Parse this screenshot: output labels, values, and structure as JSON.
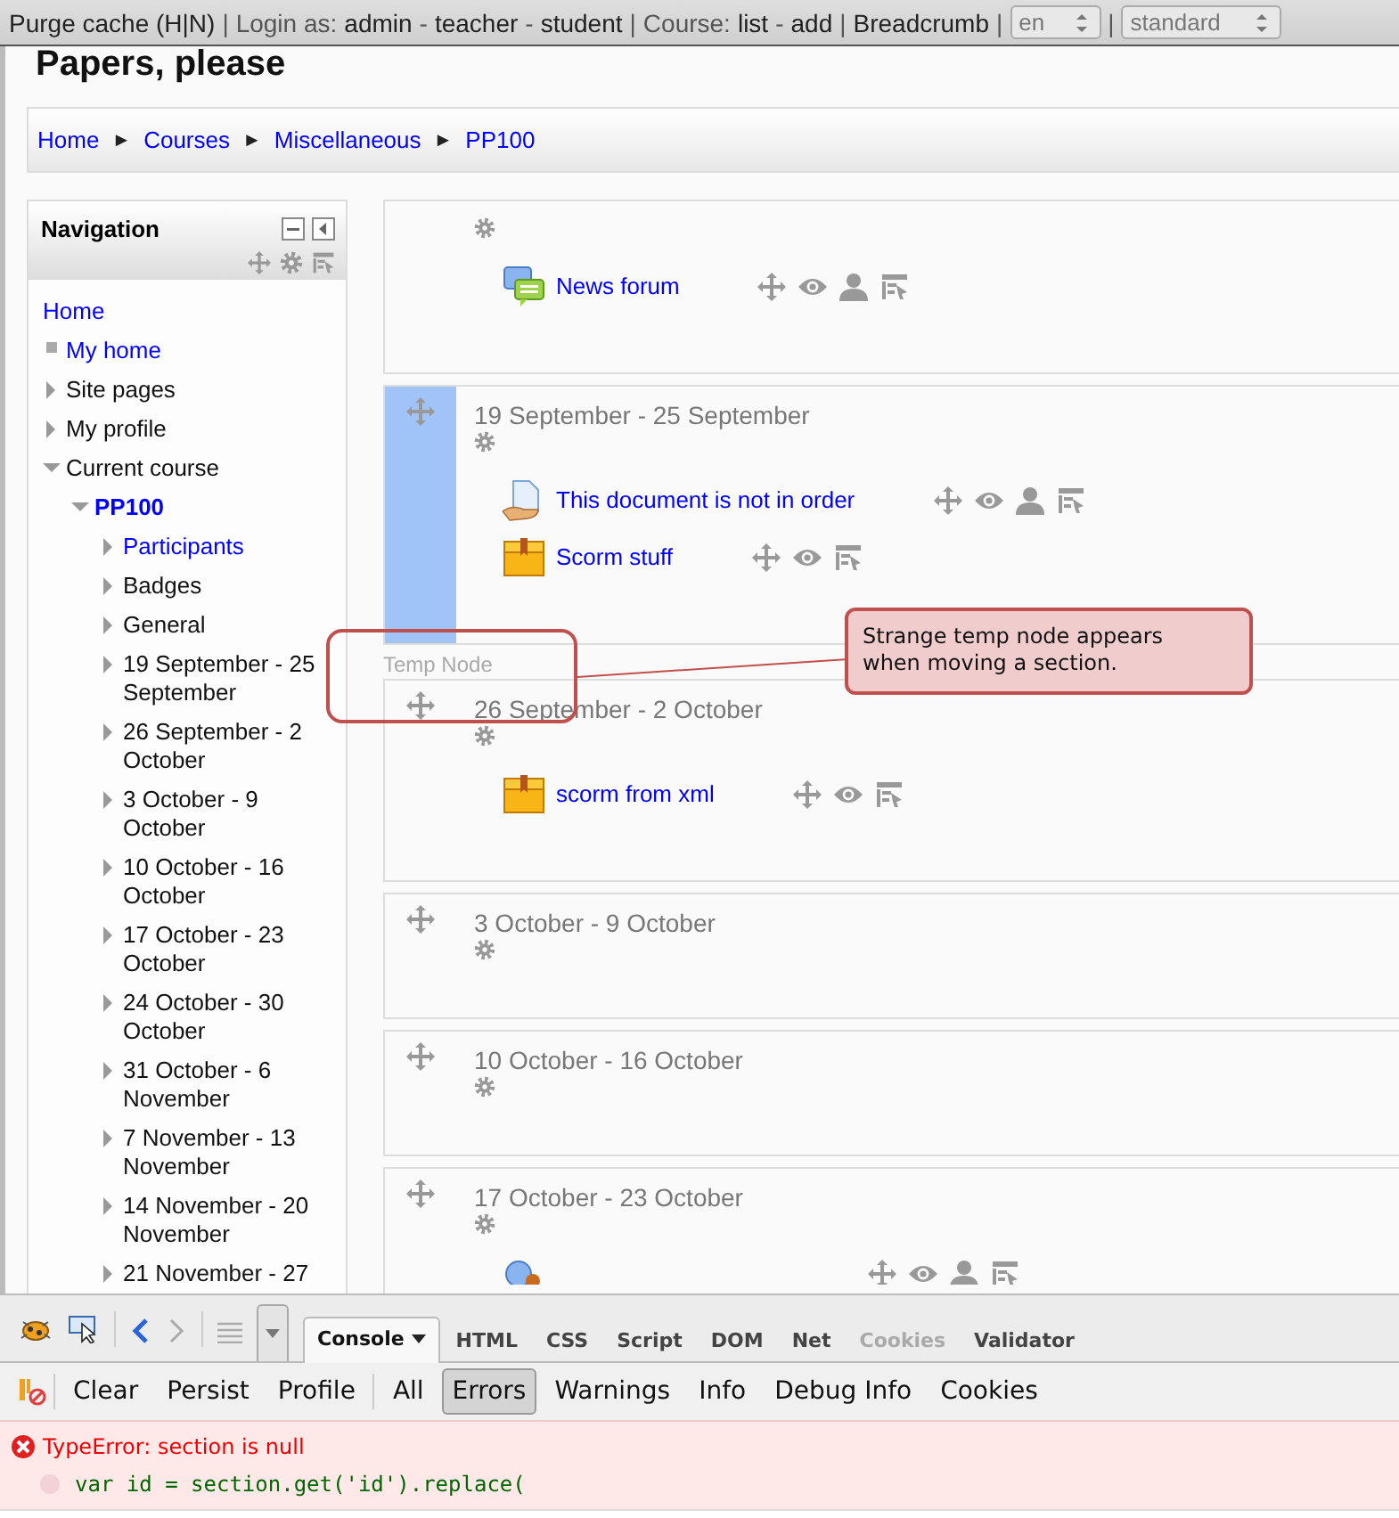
{
  "top_bar": {
    "segments": [
      {
        "kind": "link",
        "text": "Purge cache (H|N)"
      },
      {
        "kind": "sep",
        "text": "|"
      },
      {
        "kind": "label",
        "text": "Login as:"
      },
      {
        "kind": "link",
        "text": "admin"
      },
      {
        "kind": "sep",
        "text": "-"
      },
      {
        "kind": "link",
        "text": "teacher"
      },
      {
        "kind": "sep",
        "text": "-"
      },
      {
        "kind": "link",
        "text": "student"
      },
      {
        "kind": "sep",
        "text": "|"
      },
      {
        "kind": "label",
        "text": "Course:"
      },
      {
        "kind": "link",
        "text": "list"
      },
      {
        "kind": "sep",
        "text": "-"
      },
      {
        "kind": "link",
        "text": "add"
      },
      {
        "kind": "sep",
        "text": "|"
      },
      {
        "kind": "link",
        "text": "Breadcrumb"
      },
      {
        "kind": "sep",
        "text": "|"
      },
      {
        "kind": "select",
        "text": "en"
      },
      {
        "kind": "sep",
        "text": "|"
      },
      {
        "kind": "select",
        "text": "standard"
      }
    ]
  },
  "page_title": "Papers, please",
  "breadcrumb": [
    {
      "kind": "link",
      "text": "Home"
    },
    {
      "kind": "sep",
      "text": "►"
    },
    {
      "kind": "link",
      "text": "Courses"
    },
    {
      "kind": "sep",
      "text": "►"
    },
    {
      "kind": "link",
      "text": "Miscellaneous"
    },
    {
      "kind": "sep",
      "text": "►"
    },
    {
      "kind": "link",
      "text": "PP100"
    }
  ],
  "navigation": {
    "title": "Navigation",
    "items": [
      {
        "kind": "home",
        "label": "Home",
        "link": true
      },
      {
        "kind": "leaf",
        "label": "My home",
        "link": true
      },
      {
        "kind": "branch",
        "label": "Site pages",
        "link": false,
        "expanded": false
      },
      {
        "kind": "branch",
        "label": "My profile",
        "link": false,
        "expanded": false
      },
      {
        "kind": "branch",
        "label": "Current course",
        "link": false,
        "expanded": true,
        "children": [
          {
            "kind": "branch",
            "label": "PP100",
            "link": true,
            "current": true,
            "expanded": true,
            "children": [
              {
                "kind": "branch",
                "label": "Participants",
                "link": true,
                "expanded": false
              },
              {
                "kind": "branch",
                "label": "Badges",
                "link": false,
                "expanded": false
              },
              {
                "kind": "branch",
                "label": "General",
                "link": false,
                "expanded": false
              },
              {
                "kind": "branch",
                "label": "19 September - 25 September",
                "link": false,
                "expanded": false
              },
              {
                "kind": "branch",
                "label": "26 September - 2 October",
                "link": false,
                "expanded": false
              },
              {
                "kind": "branch",
                "label": "3 October - 9 October",
                "link": false,
                "expanded": false
              },
              {
                "kind": "branch",
                "label": "10 October - 16 October",
                "link": false,
                "expanded": false
              },
              {
                "kind": "branch",
                "label": "17 October - 23 October",
                "link": false,
                "expanded": false
              },
              {
                "kind": "branch",
                "label": "24 October - 30 October",
                "link": false,
                "expanded": false
              },
              {
                "kind": "branch",
                "label": "31 October - 6 November",
                "link": false,
                "expanded": false
              },
              {
                "kind": "branch",
                "label": "7 November - 13 November",
                "link": false,
                "expanded": false
              },
              {
                "kind": "branch",
                "label": "14 November - 20 November",
                "link": false,
                "expanded": false
              },
              {
                "kind": "branch",
                "label": "21 November - 27",
                "link": false,
                "expanded": false
              }
            ]
          }
        ]
      }
    ]
  },
  "sections": [
    {
      "activities": [
        {
          "kind": "forum",
          "name": "News forum",
          "actions": [
            {
              "kind": "move"
            },
            {
              "kind": "show"
            },
            {
              "kind": "role"
            },
            {
              "kind": "edit"
            }
          ]
        }
      ]
    },
    {
      "title": "19 September - 25 September",
      "moving": true,
      "activities": [
        {
          "kind": "document",
          "name": "This document is not in order",
          "actions": [
            {
              "kind": "move"
            },
            {
              "kind": "show"
            },
            {
              "kind": "role"
            },
            {
              "kind": "edit"
            }
          ]
        },
        {
          "kind": "package",
          "name": "Scorm stuff",
          "actions": [
            {
              "kind": "move"
            },
            {
              "kind": "show"
            },
            {
              "kind": "edit"
            }
          ]
        }
      ]
    },
    {
      "title": "26 September - 2 October",
      "temp_node": "Temp Node",
      "activities": [
        {
          "kind": "package",
          "name": "scorm from xml",
          "actions": [
            {
              "kind": "move"
            },
            {
              "kind": "show"
            },
            {
              "kind": "edit"
            }
          ]
        }
      ]
    },
    {
      "title": "3 October - 9 October"
    },
    {
      "title": "10 October - 16 October"
    },
    {
      "title": "17 October - 23 October",
      "activities": [
        {
          "kind": "chat",
          "actions": [
            {
              "kind": "move"
            },
            {
              "kind": "show"
            },
            {
              "kind": "role"
            },
            {
              "kind": "edit"
            }
          ]
        }
      ]
    }
  ],
  "annotation": {
    "text": "Strange temp node appears when moving a section."
  },
  "devtools": {
    "tabs": [
      {
        "label": "Console",
        "selected": true,
        "disabled": false
      },
      {
        "label": "HTML",
        "selected": false,
        "disabled": false
      },
      {
        "label": "CSS",
        "selected": false,
        "disabled": false
      },
      {
        "label": "Script",
        "selected": false,
        "disabled": false
      },
      {
        "label": "DOM",
        "selected": false,
        "disabled": false
      },
      {
        "label": "Net",
        "selected": false,
        "disabled": false
      },
      {
        "label": "Cookies",
        "selected": false,
        "disabled": true
      },
      {
        "label": "Validator",
        "selected": false,
        "disabled": false
      }
    ],
    "commands": [
      "Clear",
      "Persist",
      "Profile"
    ],
    "filters": [
      {
        "label": "All",
        "selected": false
      },
      {
        "label": "Errors",
        "selected": true
      },
      {
        "label": "Warnings",
        "selected": false
      },
      {
        "label": "Info",
        "selected": false
      },
      {
        "label": "Debug Info",
        "selected": false
      },
      {
        "label": "Cookies",
        "selected": false
      }
    ],
    "log": [
      {
        "kind": "error",
        "text": "TypeError: section is null"
      },
      {
        "kind": "code",
        "text": "var id = section.get('id').replace("
      }
    ]
  }
}
